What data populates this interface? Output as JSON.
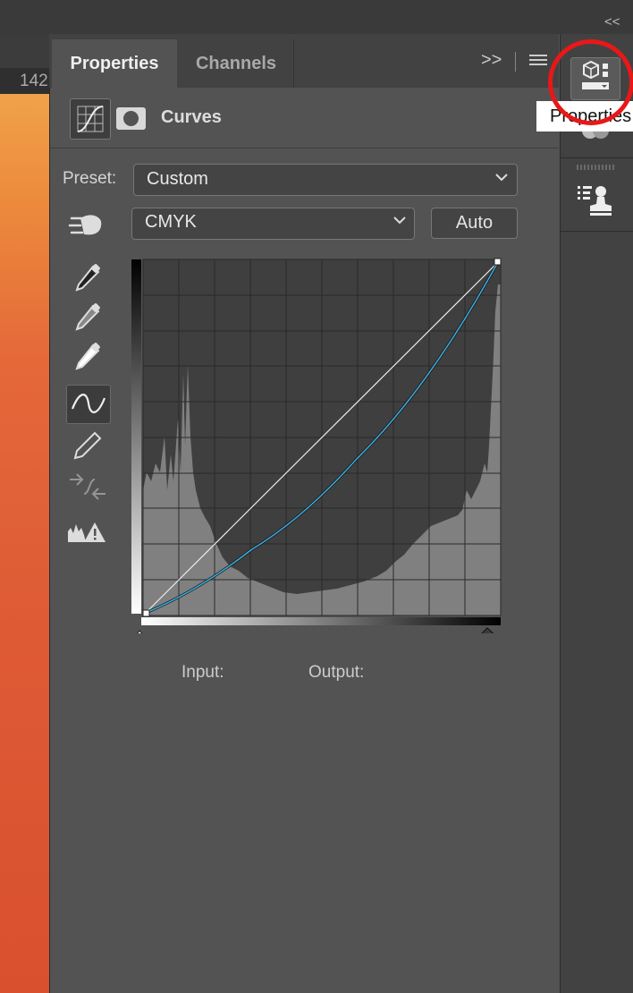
{
  "ruler": {
    "label": "142"
  },
  "panel": {
    "tabs": [
      {
        "label": "Properties",
        "active": true
      },
      {
        "label": "Channels",
        "active": false
      }
    ],
    "collapse_label": ">>",
    "title": "Curves",
    "preset": {
      "label": "Preset:",
      "value": "Custom"
    },
    "channel": {
      "value": "CMYK"
    },
    "auto_label": "Auto",
    "input_label": "Input:",
    "output_label": "Output:"
  },
  "dock": {
    "collapse_label": "<<",
    "tooltip": "Properties"
  },
  "icons": [
    "curves-adjustment-icon",
    "mask-icon",
    "hand-target-adjust-icon",
    "black-point-eyedropper-icon",
    "gray-point-eyedropper-icon",
    "white-point-eyedropper-icon",
    "curve-point-tool-icon",
    "pencil-icon",
    "smooth-icon",
    "histogram-warning-icon",
    "properties-icon",
    "adjustments-icon",
    "clone-source-icon"
  ],
  "curve": {
    "color": "#3fa9d8",
    "points": [
      [
        0,
        0
      ],
      [
        30,
        18
      ],
      [
        60,
        44
      ],
      [
        100,
        100
      ]
    ]
  }
}
